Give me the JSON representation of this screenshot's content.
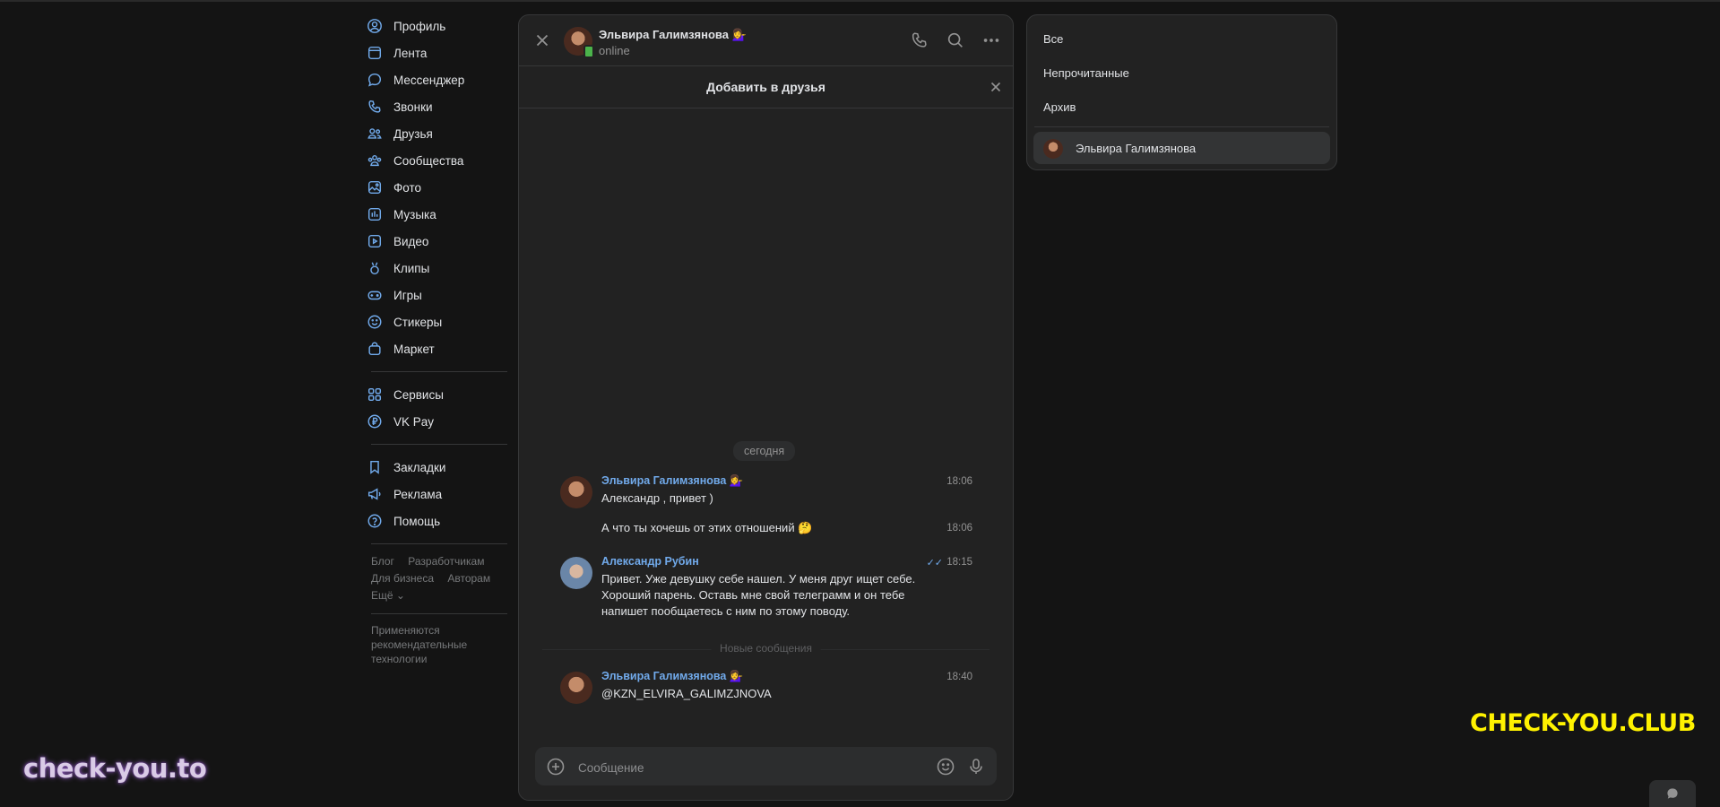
{
  "nav": {
    "items": [
      {
        "label": "Профиль",
        "icon": "user-circle-icon"
      },
      {
        "label": "Лента",
        "icon": "feed-icon"
      },
      {
        "label": "Мессенджер",
        "icon": "message-icon"
      },
      {
        "label": "Звонки",
        "icon": "phone-icon"
      },
      {
        "label": "Друзья",
        "icon": "friends-icon"
      },
      {
        "label": "Сообщества",
        "icon": "communities-icon"
      },
      {
        "label": "Фото",
        "icon": "photo-icon"
      },
      {
        "label": "Музыка",
        "icon": "music-icon"
      },
      {
        "label": "Видео",
        "icon": "video-icon"
      },
      {
        "label": "Клипы",
        "icon": "clips-icon"
      },
      {
        "label": "Игры",
        "icon": "gamepad-icon"
      },
      {
        "label": "Стикеры",
        "icon": "smile-icon"
      },
      {
        "label": "Маркет",
        "icon": "bag-icon"
      }
    ],
    "items2": [
      {
        "label": "Сервисы",
        "icon": "grid-icon"
      },
      {
        "label": "VK Pay",
        "icon": "ruble-icon"
      }
    ],
    "items3": [
      {
        "label": "Закладки",
        "icon": "bookmark-icon"
      },
      {
        "label": "Реклама",
        "icon": "megaphone-icon"
      },
      {
        "label": "Помощь",
        "icon": "help-icon"
      }
    ],
    "footer": {
      "blog": "Блог",
      "developers": "Разработчикам",
      "business": "Для бизнеса",
      "authors": "Авторам",
      "more": "Ещё ⌄",
      "note": "Применяются рекомендательные технологии"
    }
  },
  "chat": {
    "header": {
      "name": "Эльвира Галимзянова 💁‍♀️",
      "status": "online"
    },
    "add_friend": "Добавить в друзья",
    "date": "сегодня",
    "messages": [
      {
        "author": "Эльвира Галимзянова 💁‍♀️",
        "time": "18:06",
        "text": "Александр , привет )"
      },
      {
        "author": "",
        "time": "18:06",
        "text": "А что ты хочешь от этих отношений 🤔"
      },
      {
        "author": "Александр Рубин",
        "time": "18:15",
        "ticks": "✓✓",
        "text": "Привет. Уже девушку себе нашел. У меня друг ищет себе. Хороший парень. Оставь мне свой телеграмм и он тебе напишет пообщаетесь с ним по этому поводу."
      },
      {
        "author": "Эльвира Галимзянова 💁‍♀️",
        "time": "18:40",
        "text": "@KZN_ELVIRA_GALIMZJNOVA"
      }
    ],
    "new_messages": "Новые сообщения",
    "composer": {
      "placeholder": "Сообщение"
    }
  },
  "folders": {
    "all": "Все",
    "unread": "Непрочитанные",
    "archive": "Архив",
    "chat_name": "Эльвира Галимзянова"
  },
  "watermarks": {
    "left": "check-you.to",
    "right": "CHECK-YOU.CLUB"
  },
  "colors": {
    "accent": "#71aaeb",
    "background": "#141414",
    "panel": "#222222",
    "online": "#4bb34b",
    "watermark_right": "#fff200"
  }
}
